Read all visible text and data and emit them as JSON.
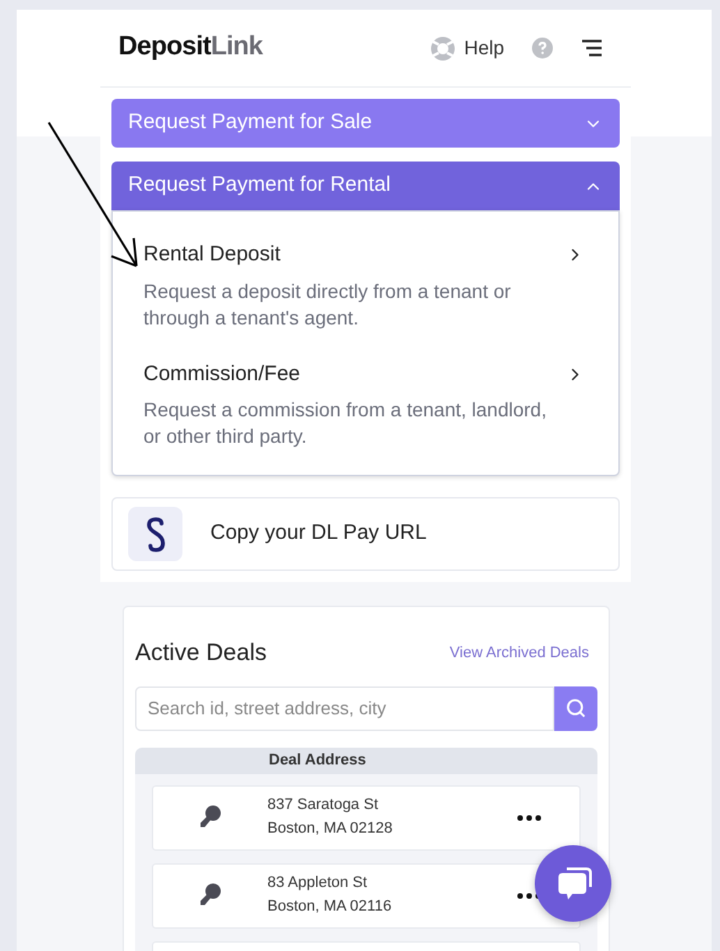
{
  "header": {
    "logo": {
      "primary": "Deposit",
      "secondary": "Link"
    },
    "help": "Help"
  },
  "accordions": [
    {
      "title": "Request Payment for Sale",
      "expanded": false
    },
    {
      "title": "Request Payment for Rental",
      "expanded": true,
      "options": [
        {
          "title": "Rental Deposit",
          "description": "Request a deposit directly from a tenant or through a tenant's agent."
        },
        {
          "title": "Commission/Fee",
          "description": "Request a commission from a tenant, landlord, or other third party."
        }
      ]
    }
  ],
  "pay_url": {
    "label": "Copy your DL Pay URL"
  },
  "active_deals": {
    "title": "Active Deals",
    "archived_link": "View Archived Deals",
    "search": {
      "placeholder": "Search id, street address, city"
    },
    "column": "Deal Address",
    "rows": [
      {
        "street": "837 Saratoga St",
        "city": "Boston, MA 02128"
      },
      {
        "street": "83 Appleton St",
        "city": "Boston, MA 02116"
      }
    ]
  }
}
